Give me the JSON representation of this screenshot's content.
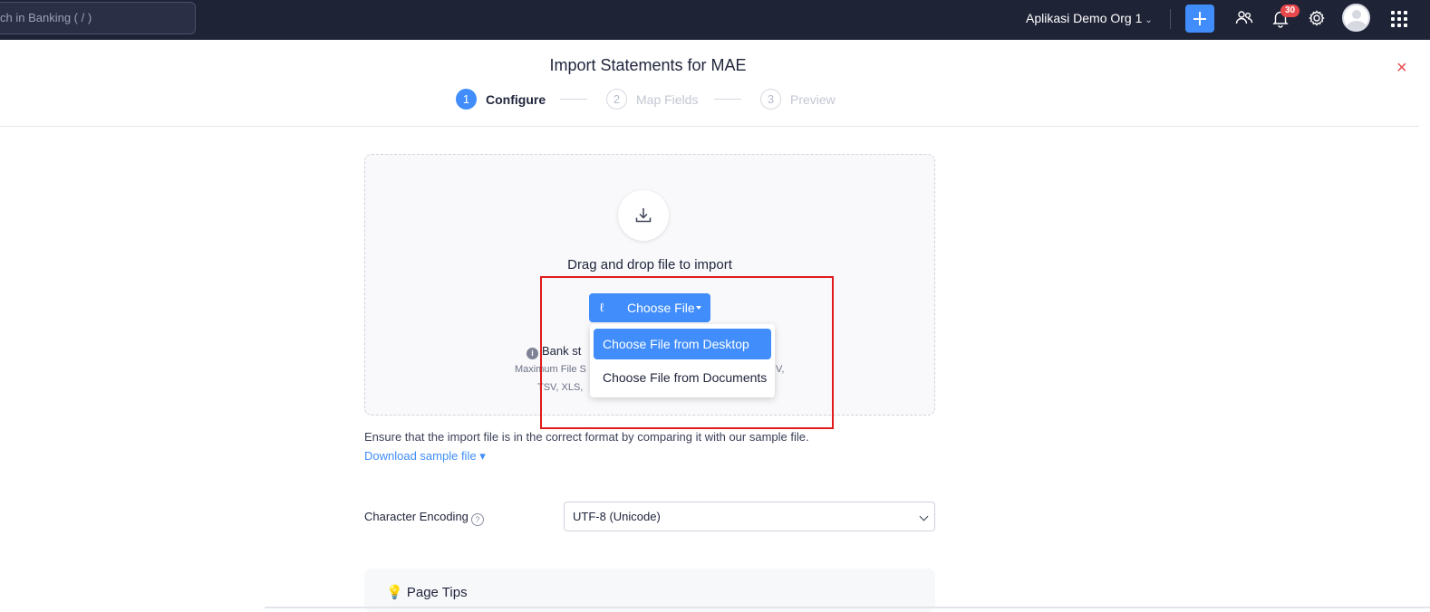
{
  "topbar": {
    "search_placeholder": "ch in Banking ( / )",
    "org_name": "Aplikasi Demo Org 1",
    "notification_count": "30"
  },
  "header": {
    "title": "Import Statements for MAE",
    "steps": [
      {
        "num": "1",
        "label": "Configure"
      },
      {
        "num": "2",
        "label": "Map Fields"
      },
      {
        "num": "3",
        "label": "Preview"
      }
    ]
  },
  "dropzone": {
    "drag_text": "Drag and drop file to import",
    "choose_label": "Choose File",
    "info_text": "Bank st",
    "size_text_left": "Maximum File S",
    "size_text_right": "V,",
    "formats_text": "TSV, XLS, "
  },
  "menu": {
    "items": [
      "Choose File from Desktop",
      "Choose File from Documents"
    ]
  },
  "ensure_text": "Ensure that the import file is in the correct format by comparing it with our sample file.",
  "download_sample": "Download sample file",
  "encoding": {
    "label": "Character Encoding",
    "value": "UTF-8 (Unicode)"
  },
  "tips": {
    "title": "Page Tips"
  },
  "colors": {
    "accent": "#408dfb",
    "topbar": "#1f2336",
    "alert": "#e8484b",
    "highlight": "#e01b1b"
  }
}
